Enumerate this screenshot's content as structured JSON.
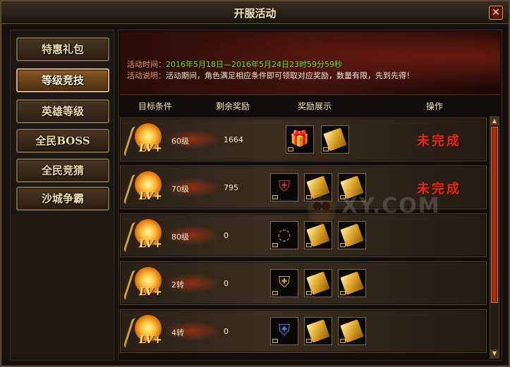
{
  "window": {
    "title": "开服活动",
    "close_label": "✕"
  },
  "sidebar": {
    "items": [
      {
        "label": "特惠礼包",
        "active": false
      },
      {
        "label": "等级竞技",
        "active": true
      },
      {
        "label": "英雄等级",
        "active": false
      },
      {
        "label": "全民BOSS",
        "active": false
      },
      {
        "label": "全民竞猜",
        "active": false
      },
      {
        "label": "沙城争霸",
        "active": false
      }
    ]
  },
  "banner": {
    "time_label": "活动时间：",
    "time_value": "2016年5月18日—2016年5月24日23时59分59秒",
    "desc_label": "活动说明：",
    "desc_value": "活动期间，角色满足相应条件即可领取对应奖励，数量有限，先到先得！"
  },
  "table": {
    "headers": {
      "target": "目标条件",
      "remaining": "剩余奖励",
      "rewards": "奖励展示",
      "action": "操作"
    },
    "badge_text": "LV+",
    "rows": [
      {
        "target": "60级",
        "remaining": "1664",
        "rewards": [
          "gift-box",
          "gold-ticket"
        ],
        "status": "未完成"
      },
      {
        "target": "70级",
        "remaining": "795",
        "rewards": [
          "armor",
          "gold-scroll",
          "gold-ticket"
        ],
        "status": "未完成"
      },
      {
        "target": "80级",
        "remaining": "0",
        "rewards": [
          "ring",
          "gold-scroll",
          "gold-ticket"
        ],
        "status": ""
      },
      {
        "target": "2转",
        "remaining": "0",
        "rewards": [
          "armor",
          "gold-scroll",
          "gold-ticket"
        ],
        "status": ""
      },
      {
        "target": "4转",
        "remaining": "0",
        "rewards": [
          "armor",
          "gold-scroll",
          "gold-ticket"
        ],
        "status": ""
      }
    ]
  },
  "watermark": "XY.COM",
  "colors": {
    "accent": "#d8b06a",
    "status": "#e22a1a",
    "time": "#5edc3a",
    "label": "#e0a060"
  }
}
